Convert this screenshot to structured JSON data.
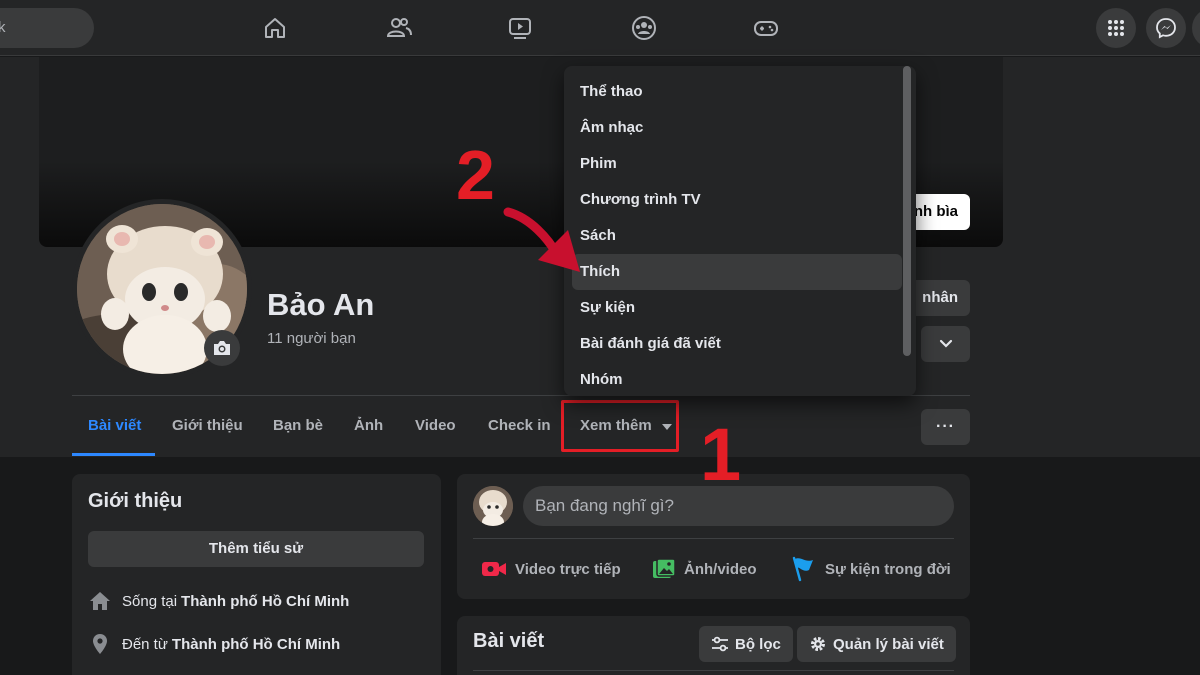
{
  "nav": {
    "search_text": "k",
    "icons": [
      "home-icon",
      "friends-icon",
      "watch-icon",
      "groups-icon",
      "gaming-icon",
      "menu-grid-icon",
      "messenger-icon"
    ]
  },
  "profile": {
    "name": "Bảo An",
    "friends_count": "11 người bạn",
    "cover_button_label": "nh bìa",
    "edit_button_label": "nhân"
  },
  "tabs": [
    {
      "label": "Bài viết",
      "active": true
    },
    {
      "label": "Giới thiệu"
    },
    {
      "label": "Bạn bè"
    },
    {
      "label": "Ảnh"
    },
    {
      "label": "Video"
    },
    {
      "label": "Check in"
    },
    {
      "label": "Xem thêm"
    }
  ],
  "more_button_label": "···",
  "dropdown": {
    "items": [
      "Thể thao",
      "Âm nhạc",
      "Phim",
      "Chương trình TV",
      "Sách",
      "Thích",
      "Sự kiện",
      "Bài đánh giá đã viết",
      "Nhóm"
    ],
    "highlighted": "Thích"
  },
  "intro": {
    "title": "Giới thiệu",
    "bio_button": "Thêm tiểu sử",
    "lives_prefix": "Sống tại",
    "lives_city": "Thành phố Hồ Chí Minh",
    "from_prefix": "Đến từ",
    "from_city": "Thành phố Hồ Chí Minh"
  },
  "composer": {
    "placeholder": "Bạn đang nghĩ gì?",
    "actions": [
      "Video trực tiếp",
      "Ảnh/video",
      "Sự kiện trong đời"
    ]
  },
  "posts": {
    "title": "Bài viết",
    "filter_label": "Bộ lọc",
    "manage_label": "Quản lý bài viết"
  },
  "annotations": {
    "step1": "1",
    "step2": "2"
  },
  "colors": {
    "accent": "#2d88ff",
    "highlight_red": "#e41e26",
    "surface": "#242526",
    "background": "#18191a"
  }
}
